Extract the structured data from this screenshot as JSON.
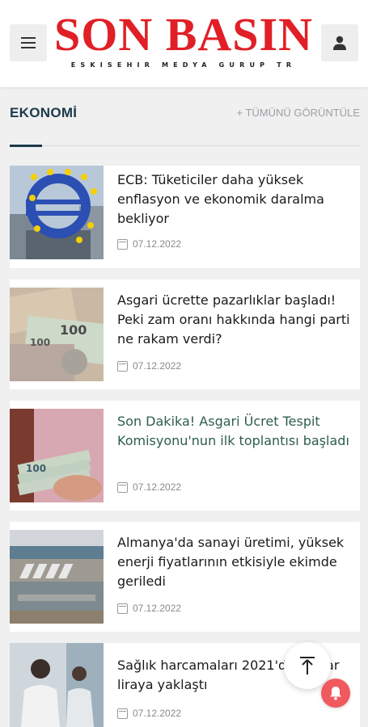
{
  "header": {
    "logo_title": "SON BASIN",
    "logo_subtitle": "ESKISEHIR MEDYA GURUP TR",
    "menu_icon": "hamburger-icon",
    "user_icon": "user-icon"
  },
  "section": {
    "title": "EKONOMİ",
    "see_all": "+ TÜMÜNÜ GÖRÜNTÜLE"
  },
  "articles": [
    {
      "title": "ECB: Tüketiciler daha yüksek enflasyon ve ekonomik daralma bekliyor",
      "date": "07.12.2022",
      "image": "euro-sign-sculpture"
    },
    {
      "title": "Asgari ücrette pazarlıklar başladı! Peki zam oranı hakkında hangi parti ne rakam verdi?",
      "date": "07.12.2022",
      "image": "lira-banknotes"
    },
    {
      "title": "Son Dakika! Asgari Ücret Tespit Komisyonu'nun ilk toplantısı başladı",
      "date": "07.12.2022",
      "image": "hand-holding-banknotes"
    },
    {
      "title": "Almanya'da sanayi üretimi, yüksek enerji fiyatlarının etkisiyle ekimde geriledi",
      "date": "07.12.2022",
      "image": "industrial-site"
    },
    {
      "title": "Sağlık harcamaları 2021'de milyar liraya yaklaştı",
      "date": "07.12.2022",
      "image": "health-workers"
    }
  ],
  "colors": {
    "brand_red": "#e01f26",
    "section_accent": "#1b3a4b",
    "highlight_title": "#2e5d4b",
    "bell": "#f0595d"
  },
  "floating": {
    "scroll_top_icon": "arrow-up-icon",
    "notification_icon": "bell-icon"
  }
}
